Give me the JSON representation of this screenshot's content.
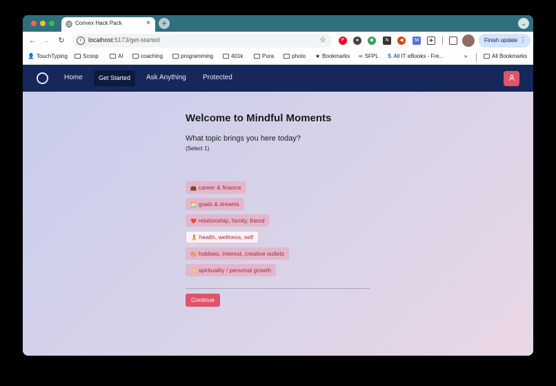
{
  "browser": {
    "tab_title": "Convex Hack Pack",
    "new_tab_glyph": "+",
    "close_glyph": "×",
    "url_host": "localhost",
    "url_path": ":5173/get-started",
    "finish_update_label": "Finish update",
    "icons": [
      "back-icon",
      "forward-icon",
      "reload-icon",
      "site-info-icon",
      "bookmark-star-icon",
      "extensions-icon",
      "side-panel-icon",
      "profile-avatar",
      "more-menu-icon"
    ]
  },
  "bookmarks": [
    {
      "label": "TouchTyping",
      "icon": "user-icon"
    },
    {
      "label": "Scoop",
      "icon": "folder-icon"
    },
    {
      "label": "AI",
      "icon": "folder-icon"
    },
    {
      "label": "coaching",
      "icon": "folder-icon"
    },
    {
      "label": "programming",
      "icon": "folder-icon"
    },
    {
      "label": "401k",
      "icon": "folder-icon"
    },
    {
      "label": "Pura",
      "icon": "folder-icon"
    },
    {
      "label": "photo",
      "icon": "folder-icon"
    },
    {
      "label": "Bookmarks",
      "icon": "star-icon"
    },
    {
      "label": "SFPL",
      "icon": "link-icon"
    },
    {
      "label": "All IT eBooks - Fre...",
      "icon": "s-logo-icon"
    }
  ],
  "bookmarks_overflow": "»",
  "all_bookmarks_label": "All Bookmarks",
  "app": {
    "nav": {
      "home": "Home",
      "get_started": "Get Started",
      "ask_anything": "Ask Anything",
      "protected": "Protected"
    },
    "colors": {
      "navbar": "#16275a",
      "accent": "#e05468",
      "chip": "#e3b7cb",
      "chip_text": "#a62a3e"
    }
  },
  "page": {
    "heading": "Welcome to Mindful Moments",
    "question": "What topic brings you here today?",
    "hint": "(Select 1)",
    "options": [
      {
        "emoji": "💼",
        "label": "career & finance",
        "selected": false
      },
      {
        "emoji": "🌅",
        "label": "goals & dreams",
        "selected": false
      },
      {
        "emoji": "❤️",
        "label": "relationship, family, friend",
        "selected": false
      },
      {
        "emoji": "🧘",
        "label": "health, wellness, self",
        "selected": true
      },
      {
        "emoji": "🎨",
        "label": "hobbies, interest, creative outlets",
        "selected": false
      },
      {
        "emoji": "✨",
        "label": "spirituality / personal growth",
        "selected": false
      }
    ],
    "continue_label": "Continue"
  }
}
